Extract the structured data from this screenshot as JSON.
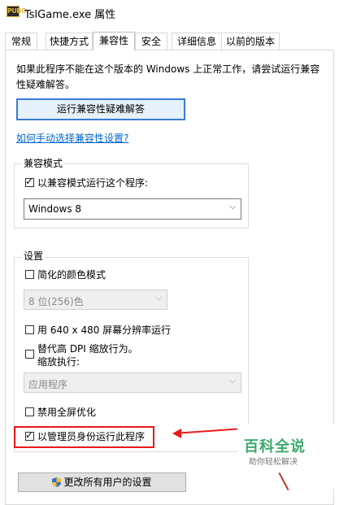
{
  "window": {
    "title": "TslGame.exe 属性",
    "icon_text": "PUBG"
  },
  "tabs": [
    {
      "label": "常规",
      "active": false
    },
    {
      "label": "快捷方式",
      "active": false
    },
    {
      "label": "兼容性",
      "active": true
    },
    {
      "label": "安全",
      "active": false
    },
    {
      "label": "详细信息",
      "active": false
    },
    {
      "label": "以前的版本",
      "active": false
    }
  ],
  "compat": {
    "description": "如果此程序不能在这个版本的 Windows 上正常工作，请尝试运行兼容性疑难解答。",
    "troubleshoot_button": "运行兼容性疑难解答",
    "manual_link": "如何手动选择兼容性设置?",
    "mode_group": {
      "label": "兼容模式",
      "checkbox_label": "以兼容模式运行这个程序:",
      "checked": true,
      "selected_os": "Windows 8"
    },
    "settings_group": {
      "label": "设置",
      "reduced_color": {
        "label": "简化的颜色模式",
        "checked": false
      },
      "color_select": "8 位(256)色",
      "res_640": {
        "label": "用 640 x 480 屏幕分辨率运行",
        "checked": false
      },
      "dpi_override": {
        "label_line1": "替代高 DPI 缩放行为。",
        "label_line2": "缩放执行:",
        "checked": false
      },
      "dpi_select": "应用程序",
      "disable_fullscreen": {
        "label": "禁用全屏优化",
        "checked": false
      },
      "run_as_admin": {
        "label": "以管理员身份运行此程序",
        "checked": true
      }
    },
    "all_users_button": "更改所有用户的设置"
  },
  "watermark": {
    "title": "百科全说",
    "subtitle": "助你轻松解决"
  },
  "colors": {
    "highlight_red": "#e8191b",
    "link_blue": "#0066cc",
    "watermark_green": "#3daa6d"
  }
}
